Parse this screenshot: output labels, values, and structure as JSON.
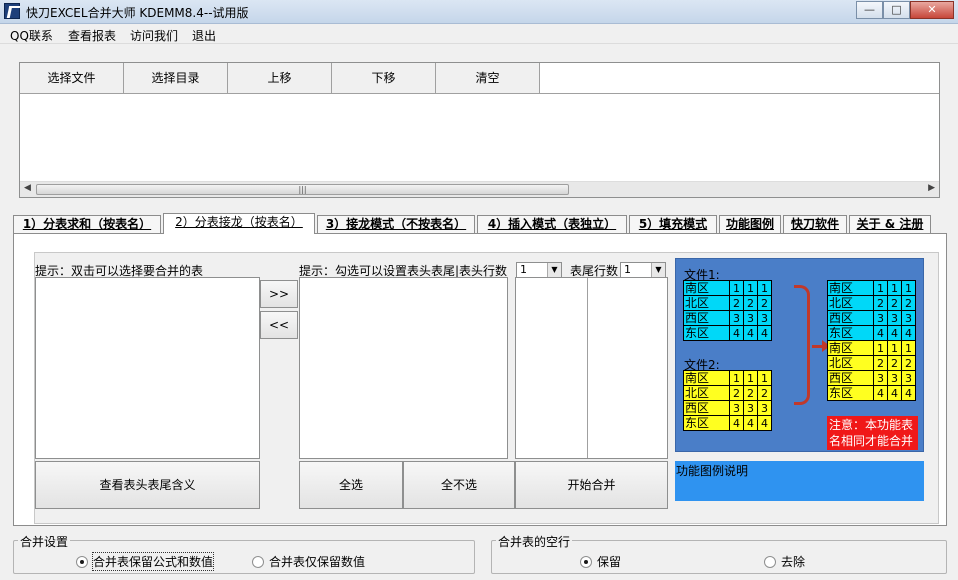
{
  "window": {
    "title": "快刀EXCEL合并大师 KDEMM8.4--试用版",
    "controls": [
      "—",
      "□",
      "✕"
    ]
  },
  "menu": [
    "QQ联系",
    "查看报表",
    "访问我们",
    "退出"
  ],
  "toolbar": {
    "buttons": [
      "选择文件",
      "选择目录",
      "上移",
      "下移",
      "清空"
    ]
  },
  "tabs": [
    "1）分表求和（按表名）",
    "2）分表接龙（按表名）",
    "3）接龙模式（不按表名）",
    "4）插入模式（表独立）",
    "5）填充模式",
    "功能图例",
    "快刀软件",
    "关于 & 注册"
  ],
  "active_tab": 1,
  "panel": {
    "hint_left": "提示：双击可以选择要合并的表",
    "hint_right": "提示：勾选可以设置表头表尾|表头行数",
    "header_rows_value": "1",
    "footer_rows_label": "表尾行数",
    "footer_rows_value": "1",
    "move_right": ">>",
    "move_left": "<<",
    "view_meaning_btn": "查看表头表尾含义",
    "select_all_btn": "全选",
    "select_none_btn": "全不选",
    "start_merge_btn": "开始合并"
  },
  "diagram": {
    "file1_label": "文件1:",
    "file2_label": "文件2:",
    "file1_rows": [
      {
        "name": "南区",
        "v": [
          "1",
          "1",
          "1"
        ]
      },
      {
        "name": "北区",
        "v": [
          "2",
          "2",
          "2"
        ]
      },
      {
        "name": "西区",
        "v": [
          "3",
          "3",
          "3"
        ]
      },
      {
        "name": "东区",
        "v": [
          "4",
          "4",
          "4"
        ]
      }
    ],
    "file2_rows": [
      {
        "name": "南区",
        "v": [
          "1",
          "1",
          "1"
        ]
      },
      {
        "name": "北区",
        "v": [
          "2",
          "2",
          "2"
        ]
      },
      {
        "name": "西区",
        "v": [
          "3",
          "3",
          "3"
        ]
      },
      {
        "name": "东区",
        "v": [
          "4",
          "4",
          "4"
        ]
      }
    ],
    "note_line1": "注意：本功能表",
    "note_line2": "名相同才能合并",
    "colors": {
      "background": "#4a7ec8",
      "file1": "#00d8f8",
      "file2": "#ffff20",
      "note": "#f01818",
      "arrow": "#c0392b"
    }
  },
  "description_label": "功能图例说明",
  "merge_settings": {
    "legend": "合并设置",
    "option_formula": "合并表保留公式和数值",
    "option_values": "合并表仅保留数值",
    "selected": "option_formula"
  },
  "empty_rows": {
    "legend": "合并表的空行",
    "option_keep": "保留",
    "option_remove": "去除",
    "selected": "option_keep"
  }
}
